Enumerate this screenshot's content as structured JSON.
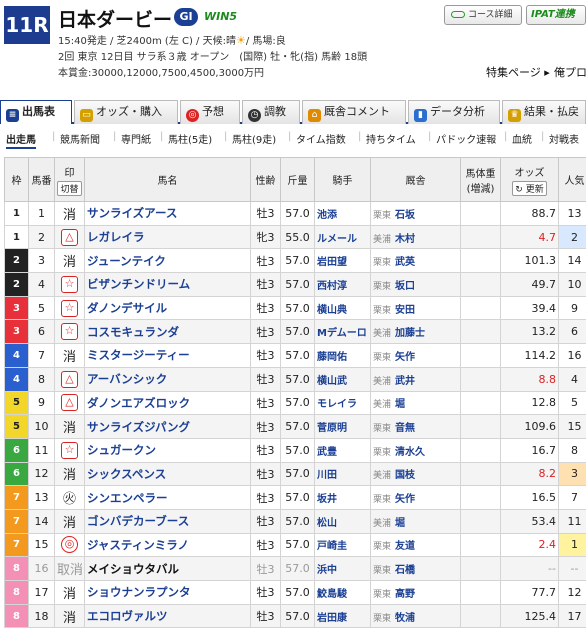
{
  "race": {
    "number": "11R",
    "name": "日本ダービー",
    "grade": "GⅠ",
    "win5": "WIN5",
    "info_line1_a": "15:40発走 / 芝2400m (左 C) / 天候:晴",
    "info_line1_b": "/ 馬場:良",
    "info_line2": "2回 東京 12日目 サラ系３歳 オープン　(国際) 牡・牝(指) 馬齢 18頭",
    "info_line3": "本賞金:30000,12000,7500,4500,3000万円",
    "special": "特集ページ ▸",
    "prev": "俺プロ"
  },
  "buttons": {
    "course": "コース詳細",
    "ipat": "IPAT連携"
  },
  "icons": {
    "weather": "sun-icon",
    "course": "course-icon"
  },
  "tabs": [
    {
      "label": "出馬表",
      "icon": "table-icon",
      "color": "#1a3f93"
    },
    {
      "label": "オッズ・購入",
      "icon": "ticket-icon",
      "color": "#d4a000"
    },
    {
      "label": "予想",
      "icon": "target-icon",
      "color": "#d22"
    },
    {
      "label": "調教",
      "icon": "clock-icon",
      "color": "#333"
    },
    {
      "label": "厩舎コメント",
      "icon": "house-icon",
      "color": "#e08a00"
    },
    {
      "label": "データ分析",
      "icon": "chart-icon",
      "color": "#2a6fd0"
    },
    {
      "label": "結果・払戻",
      "icon": "trophy-icon",
      "color": "#d4a000"
    }
  ],
  "subnav": [
    "出走馬",
    "競馬新聞",
    "専門紙",
    "馬柱(5走)",
    "馬柱(9走)",
    "タイム指数",
    "持ちタイム",
    "パドック速報",
    "血統",
    "対戦表"
  ],
  "table": {
    "headers": {
      "waku": "枠",
      "umaban": "馬番",
      "mark": "印",
      "mark_btn": "切替",
      "horse": "馬名",
      "sex": "性齢",
      "weight": "斤量",
      "jockey": "騎手",
      "stable": "厩舎",
      "body": "馬体重(増減)",
      "odds": "オッズ",
      "odds_btn": "更新",
      "ninki": "人気"
    },
    "rows": [
      {
        "waku": "1",
        "umaban": "1",
        "mark": "消",
        "horse": "サンライズアース",
        "sex": "牡3",
        "wt": "57.0",
        "jockey": "池添",
        "area": "栗東",
        "trainer": "石坂",
        "odds": "88.7",
        "ninki": "13"
      },
      {
        "waku": "1",
        "umaban": "2",
        "mark": "△",
        "horse": "レガレイラ",
        "sex": "牝3",
        "wt": "55.0",
        "jockey": "ルメール",
        "area": "美浦",
        "trainer": "木村",
        "odds": "4.7",
        "ninki": "2"
      },
      {
        "waku": "2",
        "umaban": "3",
        "mark": "消",
        "horse": "ジューンテイク",
        "sex": "牡3",
        "wt": "57.0",
        "jockey": "岩田望",
        "area": "栗東",
        "trainer": "武英",
        "odds": "101.3",
        "ninki": "14"
      },
      {
        "waku": "2",
        "umaban": "4",
        "mark": "☆",
        "horse": "ビザンチンドリーム",
        "sex": "牡3",
        "wt": "57.0",
        "jockey": "西村淳",
        "area": "栗東",
        "trainer": "坂口",
        "odds": "49.7",
        "ninki": "10"
      },
      {
        "waku": "3",
        "umaban": "5",
        "mark": "☆",
        "horse": "ダノンデサイル",
        "sex": "牡3",
        "wt": "57.0",
        "jockey": "横山典",
        "area": "栗東",
        "trainer": "安田",
        "odds": "39.4",
        "ninki": "9"
      },
      {
        "waku": "3",
        "umaban": "6",
        "mark": "☆",
        "horse": "コスモキュランダ",
        "sex": "牡3",
        "wt": "57.0",
        "jockey": "Mデムーロ",
        "area": "美浦",
        "trainer": "加藤士",
        "odds": "13.2",
        "ninki": "6"
      },
      {
        "waku": "4",
        "umaban": "7",
        "mark": "消",
        "horse": "ミスタージーティー",
        "sex": "牡3",
        "wt": "57.0",
        "jockey": "藤岡佑",
        "area": "栗東",
        "trainer": "矢作",
        "odds": "114.2",
        "ninki": "16"
      },
      {
        "waku": "4",
        "umaban": "8",
        "mark": "△",
        "horse": "アーバンシック",
        "sex": "牡3",
        "wt": "57.0",
        "jockey": "横山武",
        "area": "美浦",
        "trainer": "武井",
        "odds": "8.8",
        "ninki": "4"
      },
      {
        "waku": "5",
        "umaban": "9",
        "mark": "△",
        "horse": "ダノンエアズロック",
        "sex": "牡3",
        "wt": "57.0",
        "jockey": "モレイラ",
        "area": "美浦",
        "trainer": "堀",
        "odds": "12.8",
        "ninki": "5"
      },
      {
        "waku": "5",
        "umaban": "10",
        "mark": "消",
        "horse": "サンライズジパング",
        "sex": "牡3",
        "wt": "57.0",
        "jockey": "菅原明",
        "area": "栗東",
        "trainer": "音無",
        "odds": "109.6",
        "ninki": "15"
      },
      {
        "waku": "6",
        "umaban": "11",
        "mark": "☆",
        "horse": "シュガークン",
        "sex": "牡3",
        "wt": "57.0",
        "jockey": "武豊",
        "area": "栗東",
        "trainer": "清水久",
        "odds": "16.7",
        "ninki": "8"
      },
      {
        "waku": "6",
        "umaban": "12",
        "mark": "消",
        "horse": "シックスペンス",
        "sex": "牡3",
        "wt": "57.0",
        "jockey": "川田",
        "area": "美浦",
        "trainer": "国枝",
        "odds": "8.2",
        "ninki": "3"
      },
      {
        "waku": "7",
        "umaban": "13",
        "mark": "㊋",
        "horse": "シンエンペラー",
        "sex": "牡3",
        "wt": "57.0",
        "jockey": "坂井",
        "area": "栗東",
        "trainer": "矢作",
        "odds": "16.5",
        "ninki": "7"
      },
      {
        "waku": "7",
        "umaban": "14",
        "mark": "消",
        "horse": "ゴンバデカーブース",
        "sex": "牡3",
        "wt": "57.0",
        "jockey": "松山",
        "area": "美浦",
        "trainer": "堀",
        "odds": "53.4",
        "ninki": "11"
      },
      {
        "waku": "7",
        "umaban": "15",
        "mark": "◎",
        "horse": "ジャスティンミラノ",
        "sex": "牡3",
        "wt": "57.0",
        "jockey": "戸崎圭",
        "area": "栗東",
        "trainer": "友道",
        "odds": "2.4",
        "ninki": "1"
      },
      {
        "waku": "8",
        "umaban": "16",
        "mark": "取消",
        "horse": "メイショウタバル",
        "sex": "牡3",
        "wt": "57.0",
        "jockey": "浜中",
        "area": "栗東",
        "trainer": "石橋",
        "odds": "--",
        "ninki": "--",
        "scratched": true
      },
      {
        "waku": "8",
        "umaban": "17",
        "mark": "消",
        "horse": "ショウナンラプンタ",
        "sex": "牡3",
        "wt": "57.0",
        "jockey": "鮫島駿",
        "area": "栗東",
        "trainer": "高野",
        "odds": "77.7",
        "ninki": "12"
      },
      {
        "waku": "8",
        "umaban": "18",
        "mark": "消",
        "horse": "エコロヴァルツ",
        "sex": "牡3",
        "wt": "57.0",
        "jockey": "岩田康",
        "area": "栗東",
        "trainer": "牧浦",
        "odds": "125.4",
        "ninki": "17"
      }
    ]
  },
  "colors": {
    "waku": {
      "1": "#ffffff",
      "2": "#222222",
      "3": "#e8303a",
      "4": "#2a5fcf",
      "5": "#f2d62a",
      "6": "#3aa840",
      "7": "#f39a1e",
      "8": "#f48fb5"
    },
    "waku_text": {
      "1": "#222",
      "2": "#fff",
      "3": "#fff",
      "4": "#fff",
      "5": "#222",
      "6": "#fff",
      "7": "#fff",
      "8": "#fff"
    },
    "ninki_bg": {
      "1": "#fff3a0",
      "2": "#d8e8ff",
      "3": "#ffe0b0"
    },
    "accent": "#1a3f93",
    "popular_odds": "#d22"
  }
}
